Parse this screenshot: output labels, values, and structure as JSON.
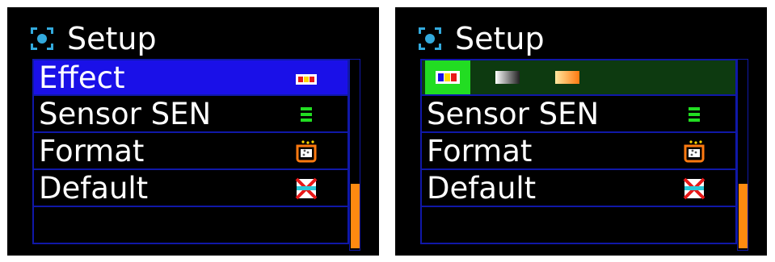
{
  "panels": [
    {
      "title": "Setup",
      "title_icon": "setup-icon",
      "items": [
        {
          "label": "Effect",
          "icon": "effect-palette-icon",
          "selected": true
        },
        {
          "label": "Sensor SEN",
          "icon": "sensor-bars-icon"
        },
        {
          "label": "Format",
          "icon": "format-card-icon"
        },
        {
          "label": "Default",
          "icon": "default-reset-icon"
        },
        {
          "label": ""
        }
      ],
      "scroll_position": 1.0
    },
    {
      "title": "Setup",
      "title_icon": "setup-icon",
      "effect_options": [
        "effect-color-icon",
        "effect-bw-icon",
        "effect-warm-icon"
      ],
      "items": [
        {
          "label": "",
          "selected": true
        },
        {
          "label": "Sensor SEN",
          "icon": "sensor-bars-icon"
        },
        {
          "label": "Format",
          "icon": "format-card-icon"
        },
        {
          "label": "Default",
          "icon": "default-reset-icon"
        },
        {
          "label": ""
        }
      ],
      "scroll_position": 1.0
    }
  ],
  "colors": {
    "highlight_blue": "#1a10e8",
    "highlight_green": "#0d3a10",
    "active_option": "#22dd22",
    "scrollbar": "#ff8a10",
    "border": "#1018a8"
  }
}
